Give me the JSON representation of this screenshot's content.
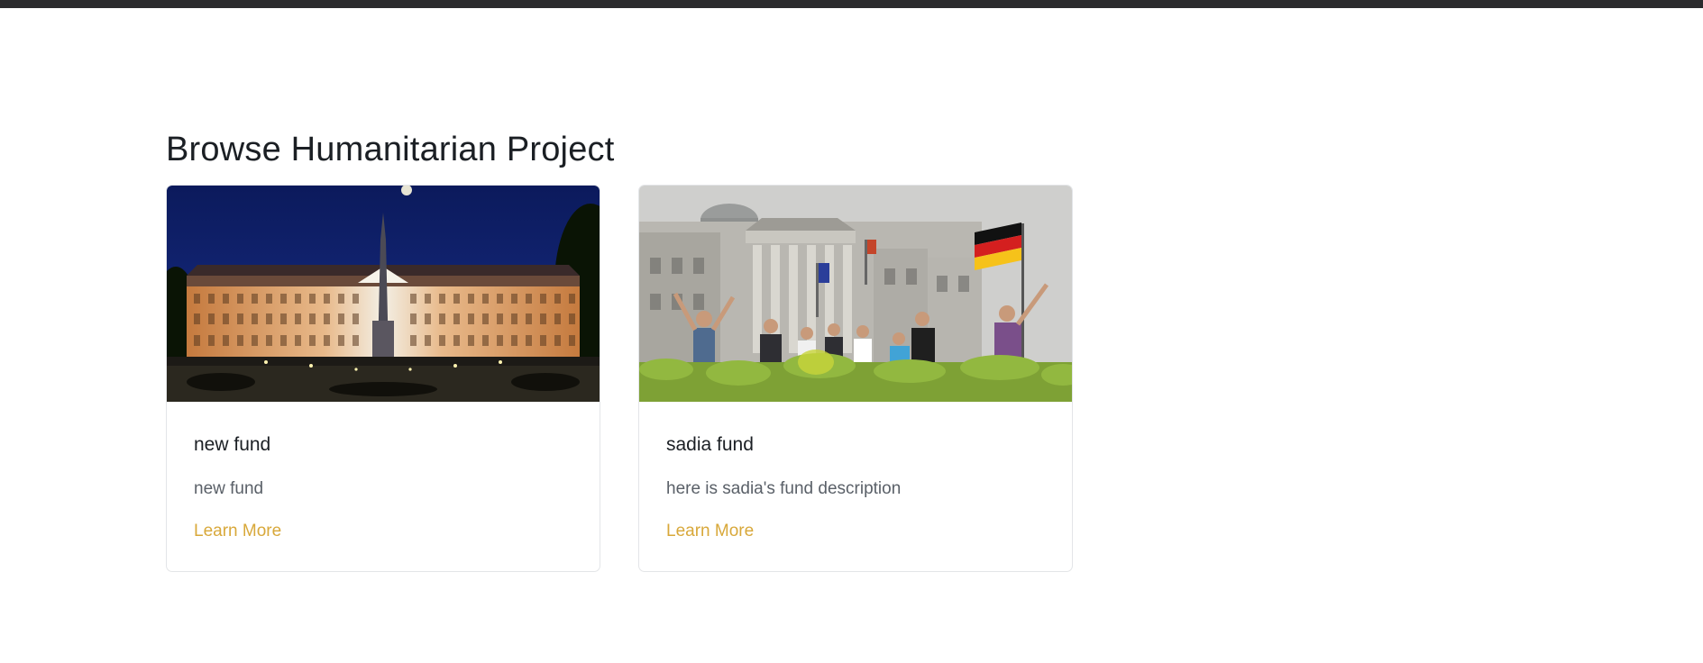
{
  "page": {
    "title": "Browse Humanitarian Project"
  },
  "cards": [
    {
      "title": "new fund",
      "description": "new fund",
      "link_label": "Learn More",
      "image_alt": "illuminated palace at night"
    },
    {
      "title": "sadia fund",
      "description": "here is sadia's fund description",
      "link_label": "Learn More",
      "image_alt": "group of people in front of parliament building with german flag"
    }
  ],
  "colors": {
    "topbar": "#2b2b2e",
    "link": "#d8a83a",
    "title": "#1b1f24",
    "muted_text": "#5a6068",
    "card_border": "#e3e5e8"
  }
}
